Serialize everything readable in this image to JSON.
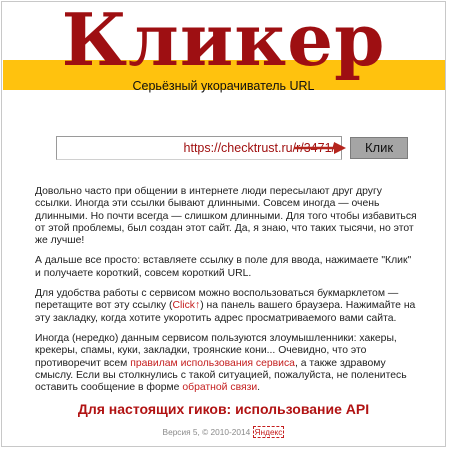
{
  "header": {
    "logo": "Кликер",
    "tagline": "Серьёзный укорачиватель URL"
  },
  "form": {
    "url_value": "https://checktrust.ru/r/3471/",
    "submit_label": "Клик"
  },
  "content": {
    "p1": "Довольно часто при общении в интернете люди пересылают друг другу ссылки. Иногда эти ссылки бывают длинными. Совсем иногда — очень длинными. Но почти всегда — слишком длинными. Для того чтобы избавиться от этой проблемы, был создан этот сайт. Да, я знаю, что таких тысячи, но этот же лучше!",
    "p2": "А дальше все просто: вставляете ссылку в поле для ввода, нажимаете \"Клик\" и получаете короткий, совсем короткий URL.",
    "p3_before": "Для удобства работы с сервисом можно воспользоваться букмарклетом — перетащите вот эту ссылку (",
    "p3_link": "Click↑",
    "p3_after": ") на панель вашего браузера. Нажимайте на эту закладку, когда хотите укоротить адрес просматриваемого вами сайта.",
    "p4_before": "Иногда (нередко) данным сервисом пользуются злоумышленники: хакеры, крекеры, спамы, куки, закладки, троянские кони... Очевидно, что это противоречит всем ",
    "p4_link1": "правилам использования сервиса",
    "p4_mid": ", а также здравому смыслу. Если вы столкнулись с такой ситуацией, пожалуйста, не поленитесь оставить сообщение в форме ",
    "p4_link2": "обратной связи",
    "p4_after": "."
  },
  "api_link": "Для настоящих гиков: использование API",
  "footer": {
    "text": "Версия 5, © 2010-2014 ",
    "yandex": "Яндекс"
  },
  "colors": {
    "brand_red": "#9e0f12",
    "band_yellow": "#ffc20e",
    "link_red": "#c41e1e"
  }
}
